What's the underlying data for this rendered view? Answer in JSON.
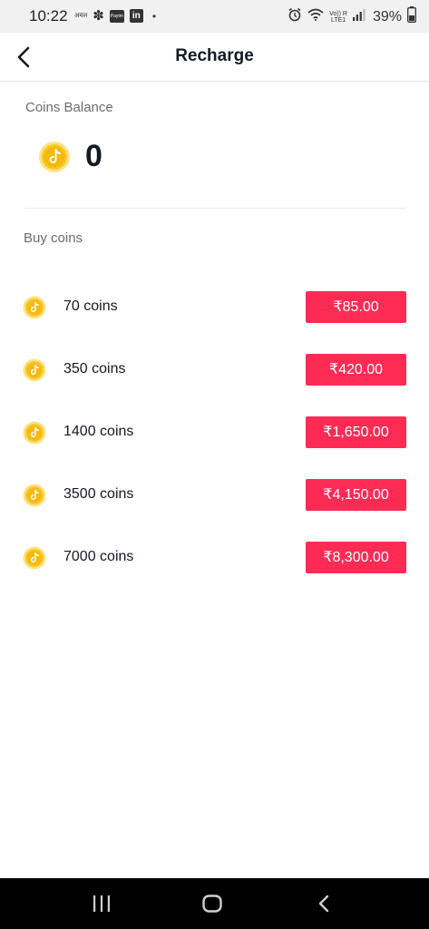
{
  "status_bar": {
    "time": "10:22",
    "notif_text": "अमल",
    "paytm_text": "Paytm",
    "linkedin_text": "in",
    "network_top": "Vo)) R",
    "network_bottom": "LTE1",
    "battery": "39%"
  },
  "header": {
    "title": "Recharge",
    "back_icon": "chevron-left-icon"
  },
  "balance": {
    "label": "Coins Balance",
    "value": "0",
    "icon": "tiktok-coin-icon"
  },
  "buy": {
    "label": "Buy coins",
    "packages": [
      {
        "coins": "70 coins",
        "price": "₹85.00"
      },
      {
        "coins": "350 coins",
        "price": "₹420.00"
      },
      {
        "coins": "1400 coins",
        "price": "₹1,650.00"
      },
      {
        "coins": "3500 coins",
        "price": "₹4,150.00"
      },
      {
        "coins": "7000 coins",
        "price": "₹8,300.00"
      }
    ]
  },
  "colors": {
    "accent": "#fe2c55",
    "coin_gold": "#f9c826",
    "text_primary": "#161823",
    "text_secondary": "#6b6c72"
  },
  "nav_bar": {
    "icons": [
      "recent-apps-icon",
      "home-icon",
      "back-icon"
    ]
  }
}
